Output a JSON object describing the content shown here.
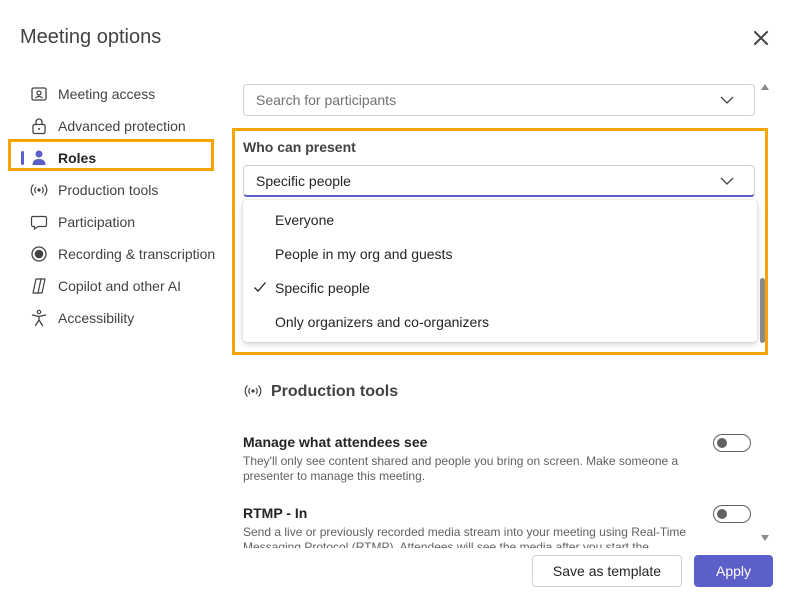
{
  "dialog": {
    "title": "Meeting options"
  },
  "sidebar": {
    "items": [
      {
        "label": "Meeting access"
      },
      {
        "label": "Advanced protection"
      },
      {
        "label": "Roles"
      },
      {
        "label": "Production tools"
      },
      {
        "label": "Participation"
      },
      {
        "label": "Recording & transcription"
      },
      {
        "label": "Copilot and other AI"
      },
      {
        "label": "Accessibility"
      }
    ],
    "active_item": "Roles"
  },
  "roles": {
    "participants_search": {
      "placeholder": "Search for participants"
    },
    "who_can_present": {
      "label": "Who can present",
      "selected": "Specific people",
      "options": [
        {
          "label": "Everyone"
        },
        {
          "label": "People in my org and guests"
        },
        {
          "label": "Specific people",
          "checked": true
        },
        {
          "label": "Only organizers and co-organizers"
        }
      ]
    }
  },
  "production_tools": {
    "title": "Production tools",
    "settings": [
      {
        "title": "Manage what attendees see",
        "description": "They'll only see content shared and people you bring on screen. Make someone a presenter to manage this meeting.",
        "enabled": false
      },
      {
        "title": "RTMP - In",
        "description": "Send a live or previously recorded media stream into your meeting using Real-Time Messaging Protocol (RTMP). Attendees will see the media after you start the meeting.",
        "enabled": false
      }
    ]
  },
  "footer": {
    "save_template_label": "Save as template",
    "apply_label": "Apply"
  },
  "colors": {
    "accent": "#5b5fc7",
    "highlight": "#f5a400"
  }
}
